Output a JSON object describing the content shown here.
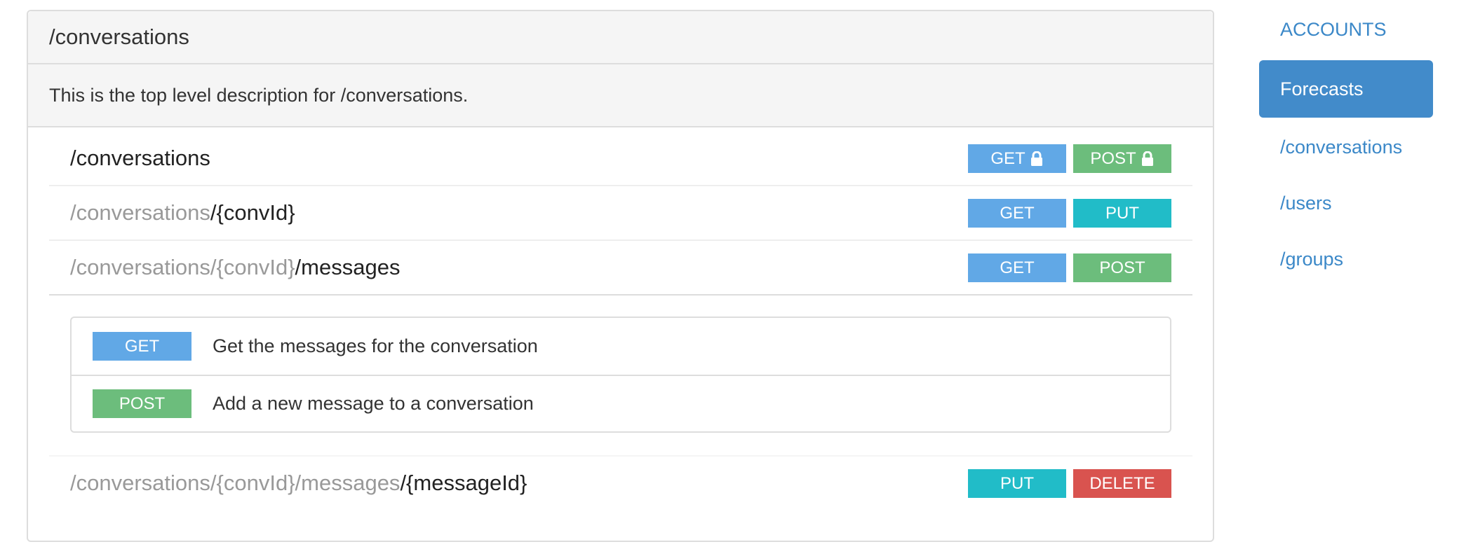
{
  "panel": {
    "title": "/conversations",
    "description": "This is the top level description for /conversations."
  },
  "resources": [
    {
      "path_top": "/conversations",
      "badges": [
        {
          "label": "GET",
          "locked": true
        },
        {
          "label": "POST",
          "locked": true
        }
      ]
    },
    {
      "path_dim": "/conversations",
      "path_cur": "/{convId}",
      "badges": [
        {
          "label": "GET"
        },
        {
          "label": "PUT"
        }
      ]
    },
    {
      "path_dim": "/conversations/{convId}",
      "path_cur": "/messages",
      "badges": [
        {
          "label": "GET"
        },
        {
          "label": "POST"
        }
      ],
      "methods": [
        {
          "method": "GET",
          "description": "Get the messages for the conversation"
        },
        {
          "method": "POST",
          "description": "Add a new message to a conversation"
        }
      ]
    },
    {
      "path_dim": "/conversations/{convId}/messages",
      "path_cur": "/{messageId}",
      "badges": [
        {
          "label": "PUT"
        },
        {
          "label": "DELETE"
        }
      ]
    }
  ],
  "nav": {
    "header": "ACCOUNTS",
    "items": [
      "Forecasts",
      "/conversations",
      "/users",
      "/groups"
    ],
    "active_index": 0
  },
  "colors": {
    "get": "#61a8e6",
    "post": "#6cbd7c",
    "put": "#21bcc8",
    "delete": "#d9534f",
    "nav_active": "#428bca",
    "link": "#3b88c8"
  },
  "icons": {
    "lock": "lock-icon"
  }
}
